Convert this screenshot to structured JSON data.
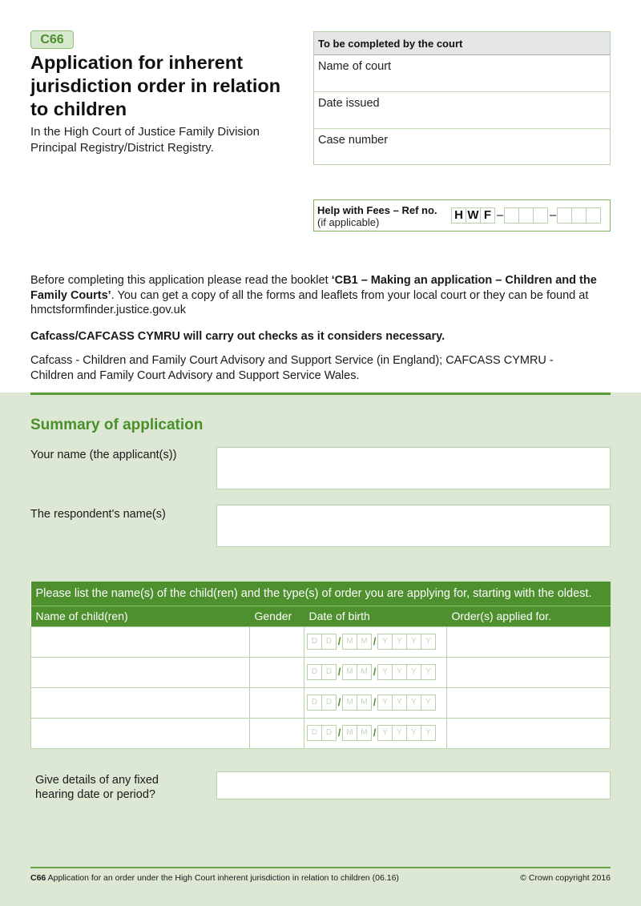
{
  "header": {
    "form_code": "C66",
    "title": "Application for inherent jurisdiction order in relation to children",
    "subtitle_line1": "In the High Court of Justice Family Division",
    "subtitle_line2": "Principal Registry/District Registry."
  },
  "court_box": {
    "heading": "To be completed by the court",
    "fields": [
      "Name of court",
      "Date issued",
      "Case number"
    ]
  },
  "help_with_fees": {
    "label": "Help with Fees – Ref no.",
    "sublabel": "(if applicable)",
    "prefix": [
      "H",
      "W",
      "F"
    ],
    "dash": "–"
  },
  "intro": {
    "text_before": "Before completing this application please read the booklet ",
    "booklet": "‘CB1 – Making an application – Children and the Family Courts’",
    "text_after": ". You can get a copy of all the forms and leaflets from your local court or they can be found at hmctsformfinder.justice.gov.uk",
    "checks": "Cafcass/CAFCASS CYMRU will carry out checks as it considers necessary.",
    "cafcass_note": "Cafcass - Children and Family Court Advisory and Support Service (in England); CAFCASS CYMRU - Children and Family Court Advisory and Support Service Wales."
  },
  "summary": {
    "title": "Summary of application",
    "applicant_label": "Your name (the applicant(s))",
    "applicant_value": "",
    "respondent_label": "The respondent's name(s)",
    "respondent_value": "",
    "hearing_label_line1": "Give details of any fixed",
    "hearing_label_line2": "hearing date or period?",
    "hearing_value": ""
  },
  "children_table": {
    "caption": "Please list the name(s) of the child(ren) and the type(s) of order you are applying for, starting with the oldest.",
    "columns": [
      "Name of child(ren)",
      "Gender",
      "Date of birth",
      "Order(s) applied for."
    ],
    "dob_placeholder": [
      "D",
      "D",
      "M",
      "M",
      "Y",
      "Y",
      "Y",
      "Y"
    ],
    "dob_separator": "/",
    "rows": [
      {
        "name": "",
        "gender": "",
        "order": ""
      },
      {
        "name": "",
        "gender": "",
        "order": ""
      },
      {
        "name": "",
        "gender": "",
        "order": ""
      },
      {
        "name": "",
        "gender": "",
        "order": ""
      }
    ]
  },
  "footer": {
    "code": "C66",
    "description": " Application for an order under the High Court inherent jurisdiction in relation to children (06.16)",
    "copyright": "© Crown copyright 2016"
  },
  "colors": {
    "brand_green": "#4e8f2e",
    "panel_bg": "#dce8d4",
    "border_green": "#b7d1a8"
  }
}
